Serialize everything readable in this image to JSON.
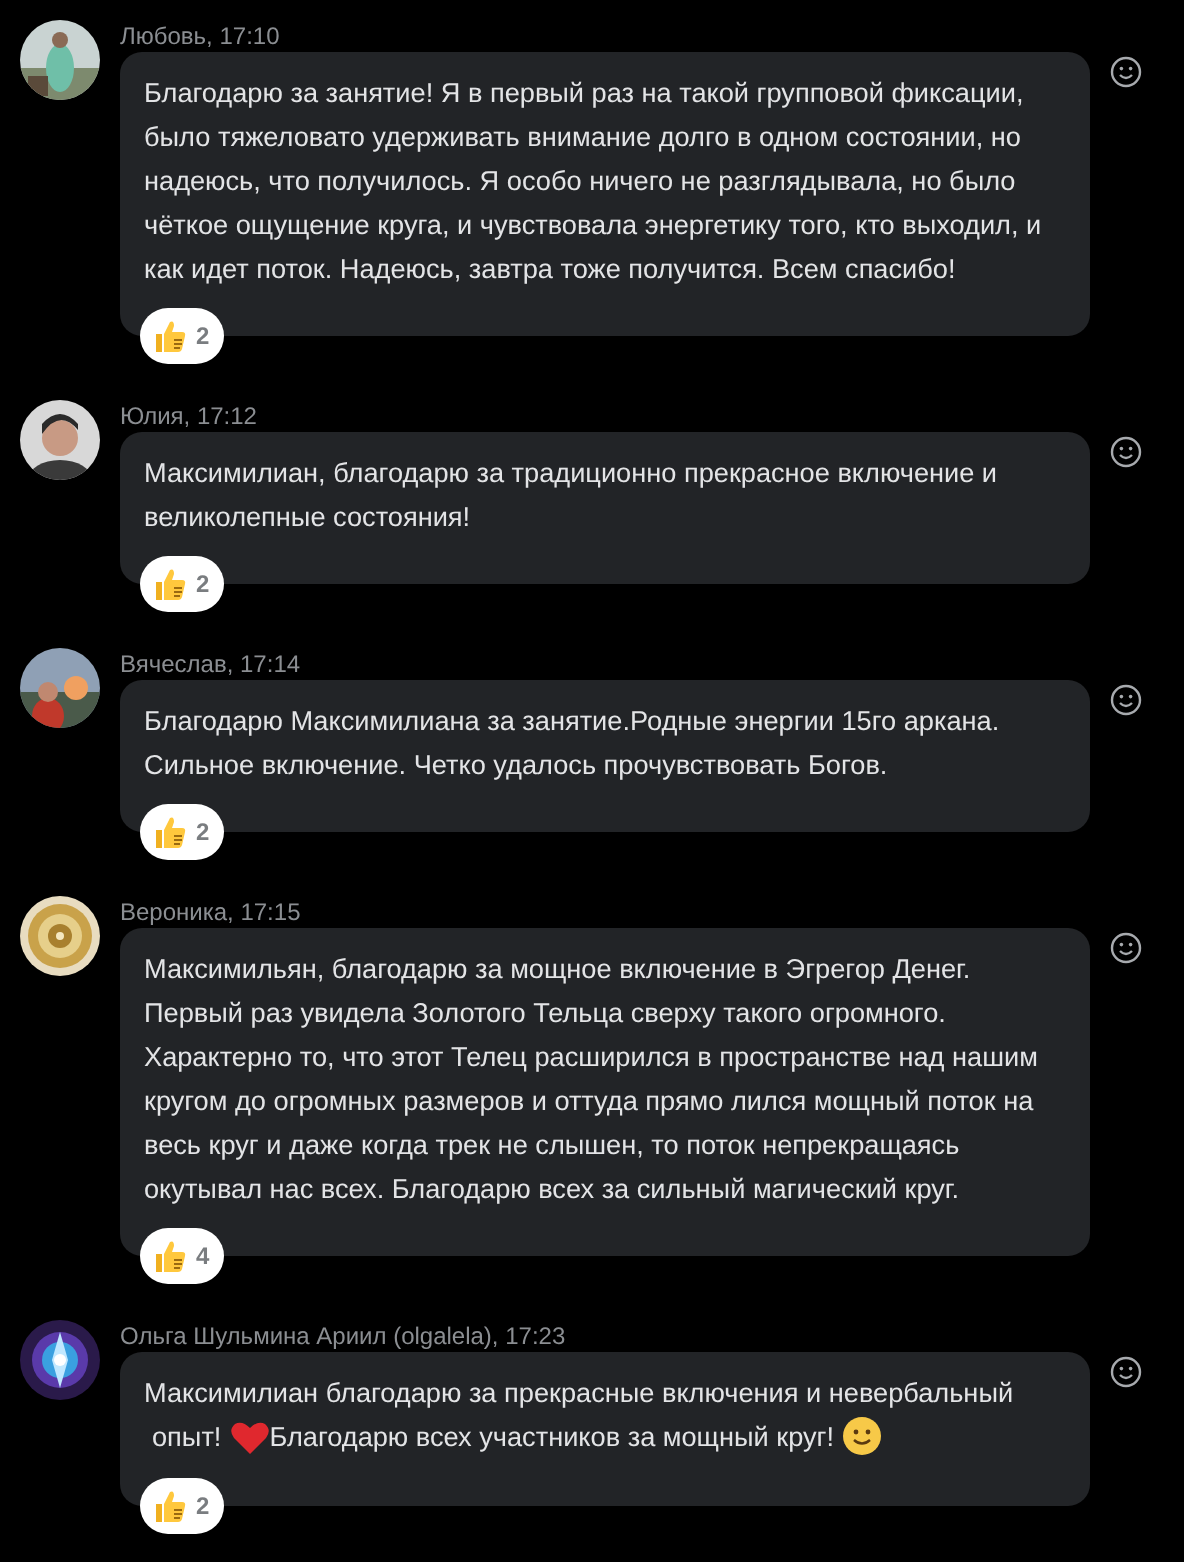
{
  "messages": [
    {
      "author": "Любовь, 17:10",
      "parts": [
        {
          "kind": "text",
          "text": "Благодарю за занятие! Я в первый раз на такой групповой фиксации, было тяжеловато удерживать внимание долго в одном состоянии, но надеюсь, что получилось. Я особо ничего не разглядывала, но было чёткое ощущение круга, и чувствовала энергетику того, кто выходил, и как идет поток. Надеюсь, завтра тоже получится. Всем спасибо!"
        }
      ],
      "reaction": {
        "count": "2"
      }
    },
    {
      "author": "Юлия, 17:12",
      "parts": [
        {
          "kind": "text",
          "text": "Максимилиан, благодарю за традиционно прекрасное включение и великолепные состояния!"
        }
      ],
      "reaction": {
        "count": "2"
      }
    },
    {
      "author": "Вячеслав, 17:14",
      "parts": [
        {
          "kind": "text",
          "text": "Благодарю Максимилиана за занятие.Родные энергии 15го аркана. Сильное включение. Четко удалось прочувствовать Богов."
        }
      ],
      "reaction": {
        "count": "2"
      }
    },
    {
      "author": "Вероника, 17:15",
      "parts": [
        {
          "kind": "text",
          "text": "Максимильян, благодарю за мощное включение в Эгрегор Денег. Первый раз увидела Золотого Тельца сверху такого огромного. Характерно то, что этот Телец расширился в пространстве над нашим кругом до огромных размеров и оттуда прямо лился мощный поток на весь круг и даже когда трек не слышен, то поток непрекращаясь окутывал нас всех. Благодарю всех за сильный магический круг."
        }
      ],
      "reaction": {
        "count": "4"
      }
    },
    {
      "author": "Ольга Шульмина Ариил (olgalela), 17:23",
      "parts": [
        {
          "kind": "text",
          "text": "Максимилиан благодарю за прекрасные включения и невербальный"
        },
        {
          "kind": "text",
          "text": "опыт!"
        },
        {
          "kind": "heart"
        },
        {
          "kind": "text",
          "text": "Благодарю всех участников за мощный круг!"
        },
        {
          "kind": "smile"
        }
      ],
      "reaction": {
        "count": "2"
      }
    }
  ]
}
